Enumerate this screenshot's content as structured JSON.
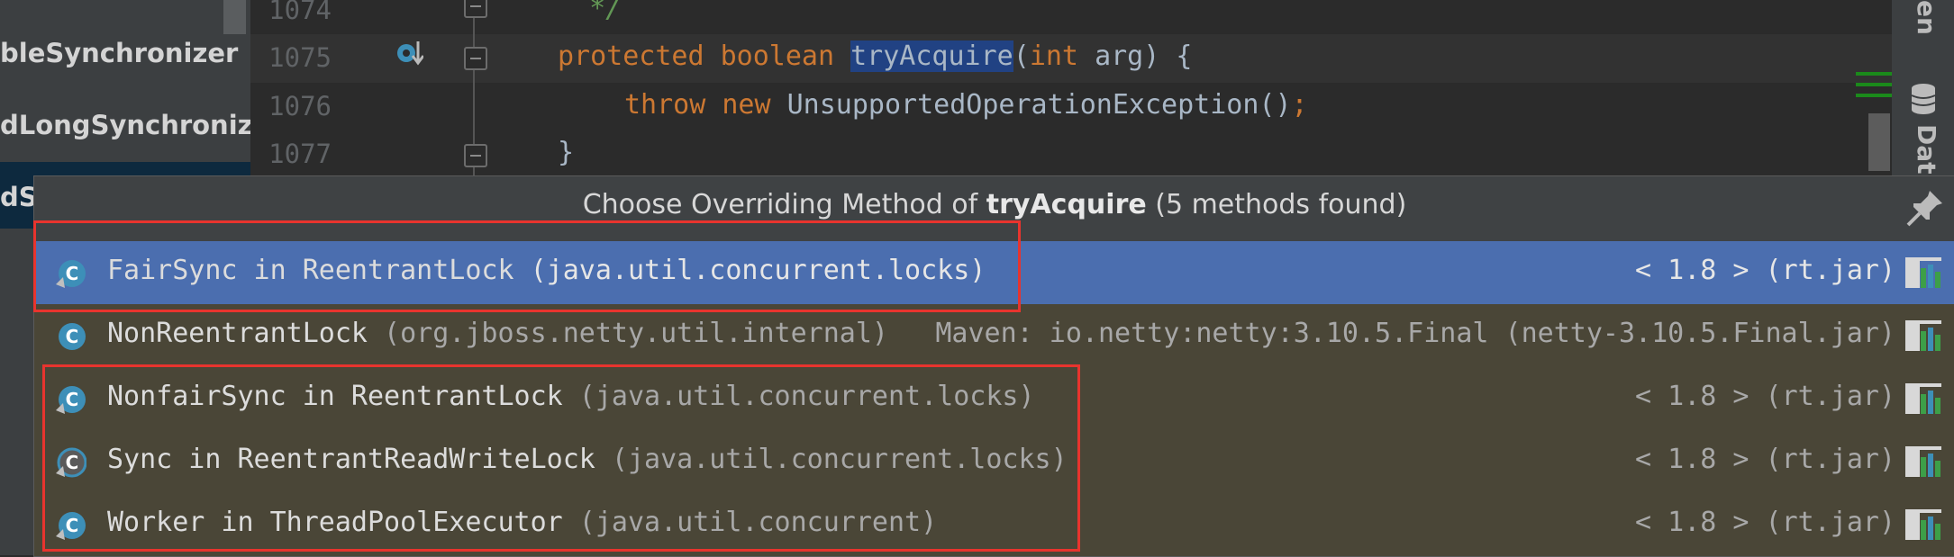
{
  "project_tree": {
    "items": [
      "bleSynchronizer",
      "dLongSynchronizer",
      "dS"
    ]
  },
  "editor": {
    "lines": [
      {
        "num": "1074",
        "tokens": [
          {
            "t": "  */",
            "c": "cmt"
          }
        ]
      },
      {
        "num": "1075",
        "tokens": [
          {
            "t": "protected ",
            "c": "kw"
          },
          {
            "t": "boolean ",
            "c": "kw"
          },
          {
            "t": "tryAcquire",
            "c": "sel"
          },
          {
            "t": "(",
            "c": "txt"
          },
          {
            "t": "int ",
            "c": "kw"
          },
          {
            "t": "arg) {",
            "c": "txt"
          }
        ]
      },
      {
        "num": "1076",
        "tokens": [
          {
            "t": "throw ",
            "c": "kw"
          },
          {
            "t": "new ",
            "c": "kw"
          },
          {
            "t": "UnsupportedOperationException()",
            "c": "txt"
          },
          {
            "t": ";",
            "c": "kw"
          }
        ]
      },
      {
        "num": "1077",
        "tokens": [
          {
            "t": "}",
            "c": "txt"
          }
        ]
      }
    ]
  },
  "side_tools": {
    "top_label": "en",
    "database_label": "Dat"
  },
  "popup": {
    "title_prefix": "Choose Overriding Method of ",
    "title_method": "tryAcquire",
    "title_suffix": " (5 methods found)",
    "rows": [
      {
        "name": "FairSync in ReentrantLock",
        "pkg": " (java.util.concurrent.locks)",
        "lib": "< 1.8 > (rt.jar)",
        "selected": true,
        "icon": "inner-class-icon"
      },
      {
        "name": "NonReentrantLock",
        "pkg": " (org.jboss.netty.util.internal)",
        "lib": "Maven: io.netty:netty:3.10.5.Final (netty-3.10.5.Final.jar)",
        "selected": false,
        "icon": "class-icon"
      },
      {
        "name": "NonfairSync in ReentrantLock",
        "pkg": " (java.util.concurrent.locks)",
        "lib": "< 1.8 > (rt.jar)",
        "selected": false,
        "icon": "inner-class-icon"
      },
      {
        "name": "Sync in ReentrantReadWriteLock",
        "pkg": " (java.util.concurrent.locks)",
        "lib": "< 1.8 > (rt.jar)",
        "selected": false,
        "icon": "abstract-inner-class-icon"
      },
      {
        "name": "Worker in ThreadPoolExecutor",
        "pkg": " (java.util.concurrent)",
        "lib": "< 1.8 > (rt.jar)",
        "selected": false,
        "icon": "inner-class-icon"
      }
    ]
  },
  "colors": {
    "selection": "#4b6eaf",
    "annotation": "#e8342e",
    "keyword": "#cc7832",
    "class_icon": "#3d8fb8"
  }
}
